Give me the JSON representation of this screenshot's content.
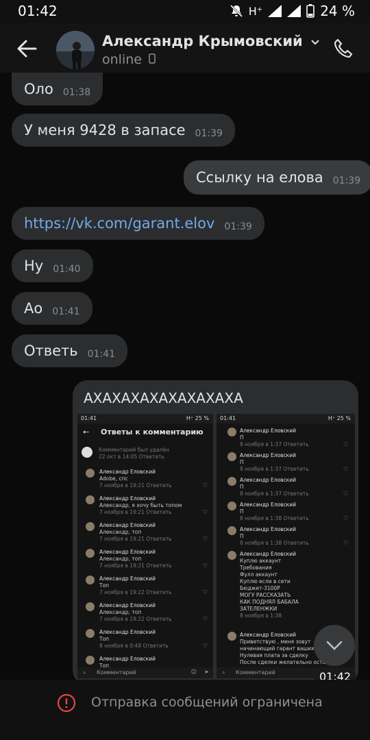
{
  "status_bar": {
    "time": "01:42",
    "network": "H⁺",
    "battery": "24 %"
  },
  "header": {
    "name": "Александр Крымовский",
    "status": "online"
  },
  "messages": [
    {
      "text": "Оло",
      "time": "01:38"
    },
    {
      "text": "У меня 9428 в запасе",
      "time": "01:39"
    },
    {
      "text": "Ссылку на елова",
      "time": "01:39"
    },
    {
      "text": "https://vk.com/garant.elov",
      "time": "01:39"
    },
    {
      "text": "Ну",
      "time": "01:40"
    },
    {
      "text": "Ао",
      "time": "01:41"
    },
    {
      "text": "Ответь",
      "time": "01:41"
    }
  ],
  "image_message": {
    "caption": "АХАХАХАХАХАХАХАХА",
    "time": "01:42",
    "shot_left": {
      "status_time": "01:41",
      "status_right": "H⁺ 25 %",
      "title": "Ответы к комментарию",
      "deleted_comment": "Комментарий был удалён",
      "deleted_date": "22 окт в 14:05",
      "reply_label": "Ответить",
      "author": "Александр Еловский",
      "reply_to": "Александр",
      "comments": [
        {
          "text": "Adobe, спс",
          "date": "7 ноября в 19:21"
        },
        {
          "text": "Александр, я хочу быть топом",
          "date": "7 ноября в 19:21"
        },
        {
          "text": "Александр, топ",
          "date": "7 ноября в 19:21"
        },
        {
          "text": "Александр, топ",
          "date": "7 ноября в 19:21"
        },
        {
          "text": "Топ",
          "date": "7 ноября в 19:22"
        },
        {
          "text": "Александр, топ",
          "date": "7 ноября в 19:22"
        },
        {
          "text": "Топ",
          "date": "8 ноября в 0:48"
        },
        {
          "text": "Топ",
          "date": ""
        }
      ],
      "input_placeholder": "Комментарий"
    },
    "shot_right": {
      "status_time": "01:41",
      "status_right": "H⁺ 25 %",
      "author": "Александр Еловский",
      "reply_label": "Ответить",
      "items": [
        {
          "text": "П",
          "date": "8 ноября в 1:37"
        },
        {
          "text": "П",
          "date": "8 ноября в 1:37"
        },
        {
          "text": "П",
          "date": "8 ноября в 1:37"
        },
        {
          "text": "П",
          "date": "8 ноября в 1:38"
        },
        {
          "text": "П",
          "date": "8 ноября в 1:38"
        }
      ],
      "long_post": [
        "Куплю аккаунт",
        "Требования",
        "Фулл аккаунт",
        "Куплю если в сети",
        "Бюджет-3100Р",
        "МОГУ РАССКАЗАТЬ",
        "КАК ПОДНЯЛ БАБАЛА",
        "ЗАТЕЛЕНЖКИ"
      ],
      "long_post_date": "8 ноября в 1:38",
      "last_post": [
        "Приветствую , меня зовут",
        "начинающий гарант ваших сд",
        "Нулевая плата за сделку",
        "После сделки желательно оста"
      ],
      "input_placeholder": "Комментарий"
    }
  },
  "bottom_bar": {
    "text": "Отправка сообщений ограничена"
  },
  "colors": {
    "bg": "#0a0a0a",
    "bubble": "#2c2d2f",
    "link": "#71aaeb",
    "warning": "#e64646"
  }
}
